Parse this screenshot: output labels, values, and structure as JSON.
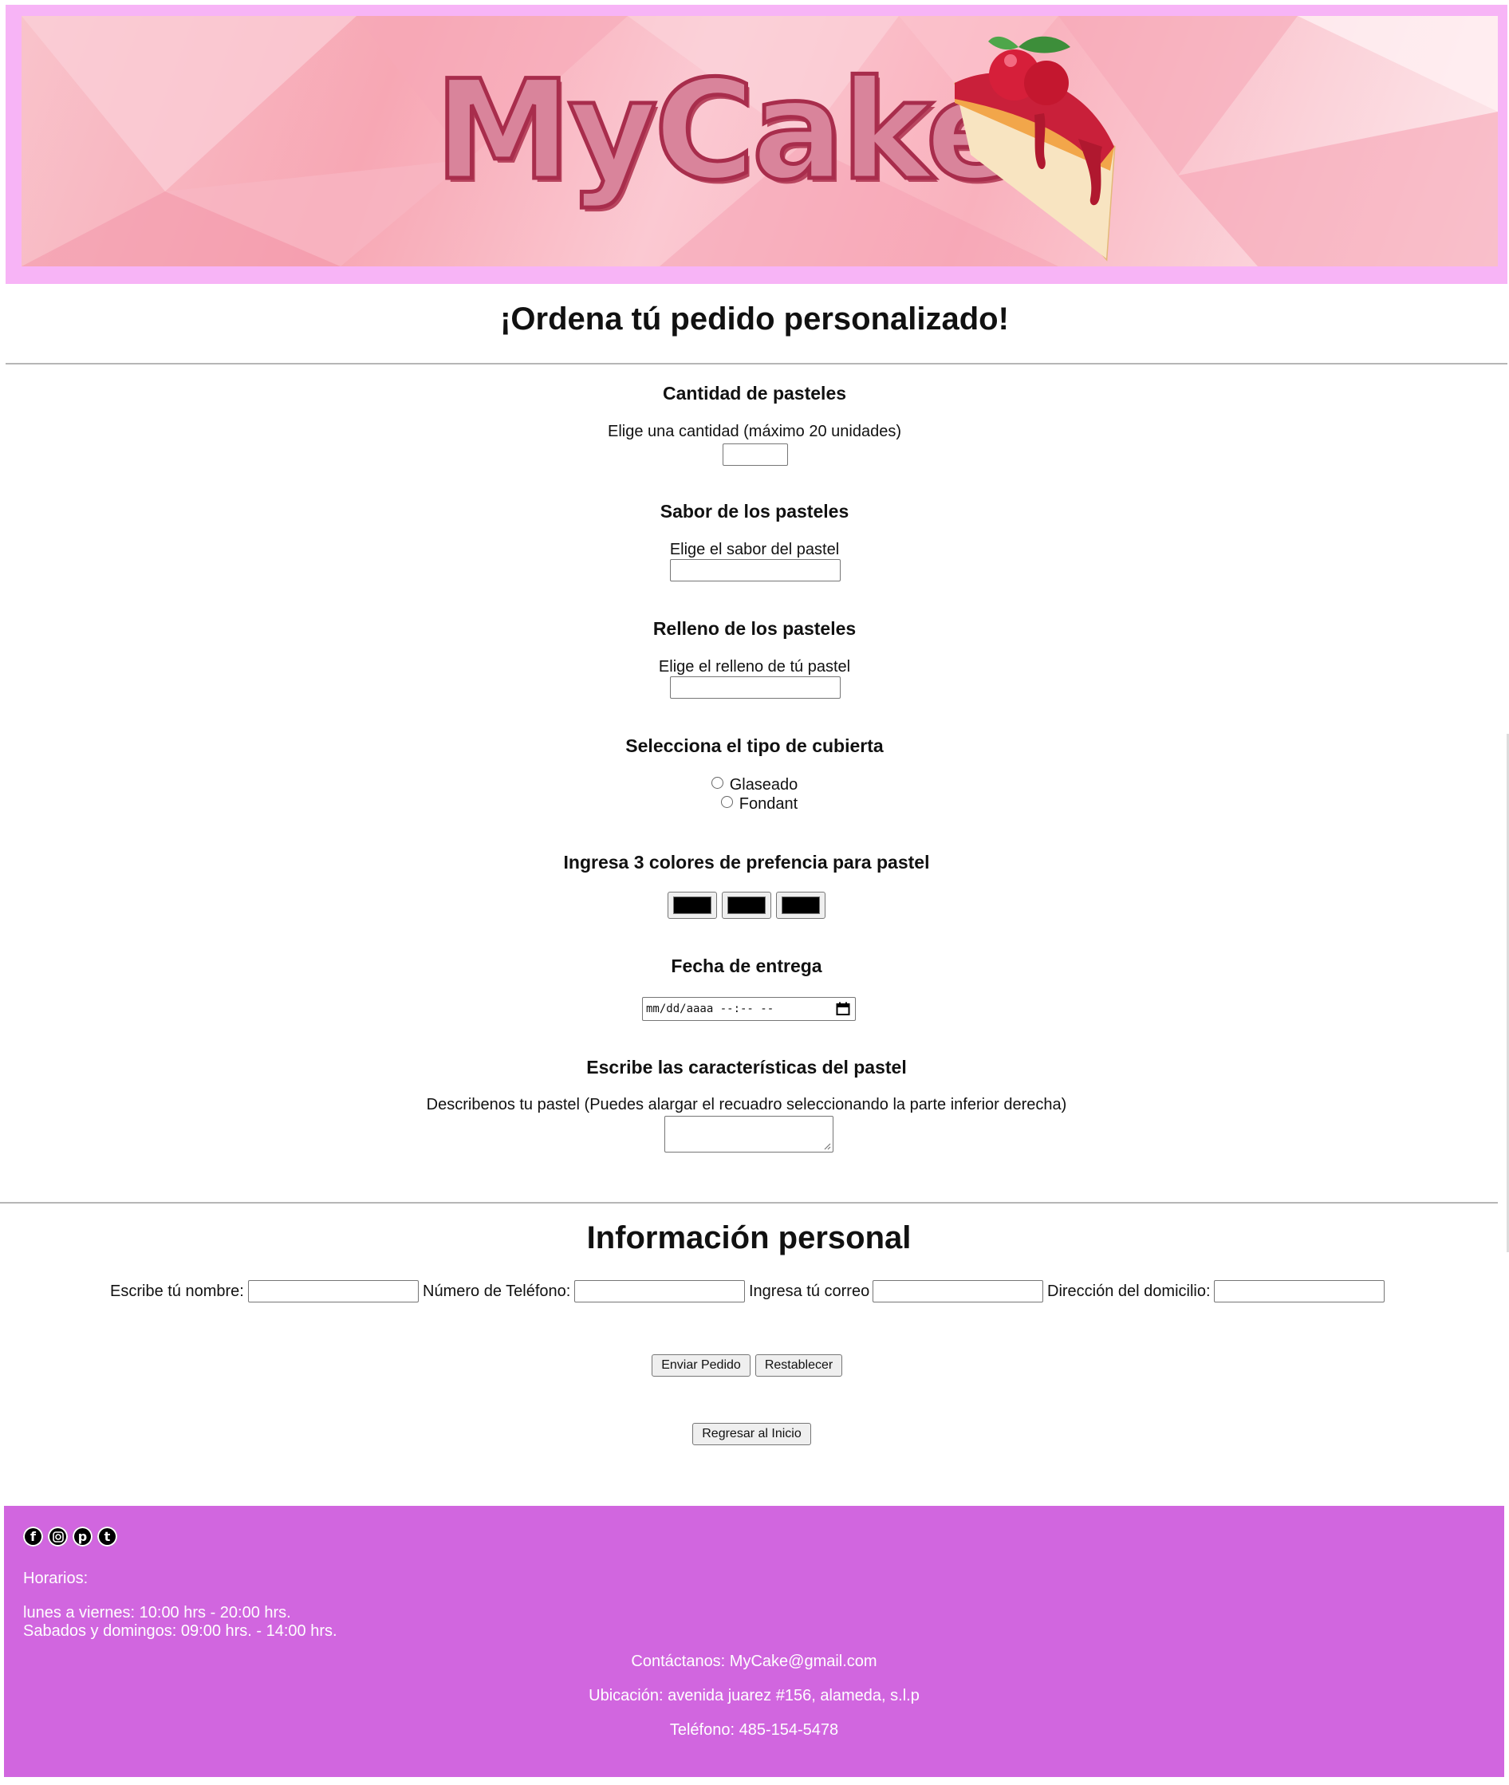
{
  "header": {
    "logo_text": "MyCake"
  },
  "page": {
    "title": "¡Ordena tú pedido personalizado!"
  },
  "form": {
    "quantity": {
      "title": "Cantidad de pasteles",
      "label": "Elige una cantidad (máximo 20 unidades)",
      "value": ""
    },
    "flavor": {
      "title": "Sabor de los pasteles",
      "label": "Elige el sabor del pastel",
      "value": ""
    },
    "filling": {
      "title": "Relleno de los pasteles",
      "label": "Elige el relleno de tú pastel",
      "value": ""
    },
    "covering": {
      "title": "Selecciona el tipo de cubierta",
      "options": [
        "Glaseado",
        "Fondant"
      ]
    },
    "colors": {
      "title": "Ingresa 3 colores de prefencia para pastel",
      "values": [
        "#000000",
        "#000000",
        "#000000"
      ]
    },
    "delivery": {
      "title": "Fecha de entrega",
      "placeholder": "mm/dd/aaaa --:-- --"
    },
    "description": {
      "title": "Escribe las características del pastel",
      "label": "Describenos tu pastel (Puedes alargar el recuadro seleccionando la parte inferior derecha)"
    }
  },
  "personal": {
    "title": "Información personal",
    "name_label": "Escribe tú nombre:",
    "phone_label": "Número de Teléfono:",
    "email_label": "Ingresa tú correo",
    "address_label": "Dirección del domicilio:"
  },
  "buttons": {
    "submit": "Enviar Pedido",
    "reset": "Restablecer",
    "home": "Regresar al Inicio"
  },
  "footer": {
    "social_icons": [
      "facebook-icon",
      "instagram-icon",
      "pinterest-icon",
      "tumblr-icon"
    ],
    "hours_title": "Horarios:",
    "weekdays": "lunes a viernes: 10:00 hrs - 20:00 hrs.",
    "weekends": "Sabados y domingos: 09:00 hrs. - 14:00 hrs.",
    "contact": "Contáctanos: MyCake@gmail.com",
    "location": "Ubicación: avenida juarez #156, alameda, s.l.p",
    "phone": "Teléfono: 485-154-5478"
  },
  "colors": {
    "banner_frame": "#f7b4f6",
    "footer_bg": "#d166df",
    "logo_fill": "#d9849b",
    "logo_outline": "#a82d4c"
  }
}
